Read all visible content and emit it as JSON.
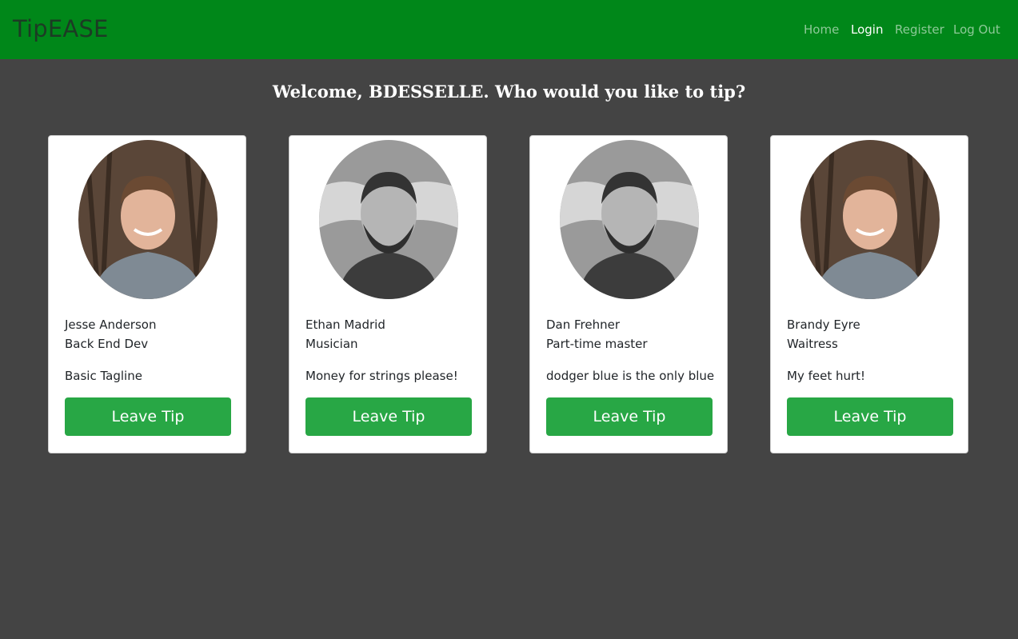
{
  "nav": {
    "brand": "TipEASE",
    "links": [
      {
        "label": "Home"
      },
      {
        "label": "Login"
      },
      {
        "label": "Register"
      },
      {
        "label": "Log Out"
      }
    ]
  },
  "main": {
    "welcome": "Welcome, BDESSELLE. Who would you like to tip?"
  },
  "cards": [
    {
      "name": "Jesse Anderson",
      "role": "Back End Dev",
      "tagline": "Basic Tagline",
      "button": "Leave Tip",
      "photo": "color-portrait"
    },
    {
      "name": "Ethan Madrid",
      "role": "Musician",
      "tagline": "Money for strings please!",
      "button": "Leave Tip",
      "photo": "grayscale-portrait"
    },
    {
      "name": "Dan Frehner",
      "role": "Part-time master",
      "tagline": "dodger blue is the only blue",
      "button": "Leave Tip",
      "photo": "grayscale-portrait"
    },
    {
      "name": "Brandy Eyre",
      "role": "Waitress",
      "tagline": "My feet hurt!",
      "button": "Leave Tip",
      "photo": "color-portrait"
    }
  ],
  "colors": {
    "navbar": "#008719",
    "background": "#444444",
    "button": "#28a745",
    "brand_text": "#1c3b24"
  }
}
